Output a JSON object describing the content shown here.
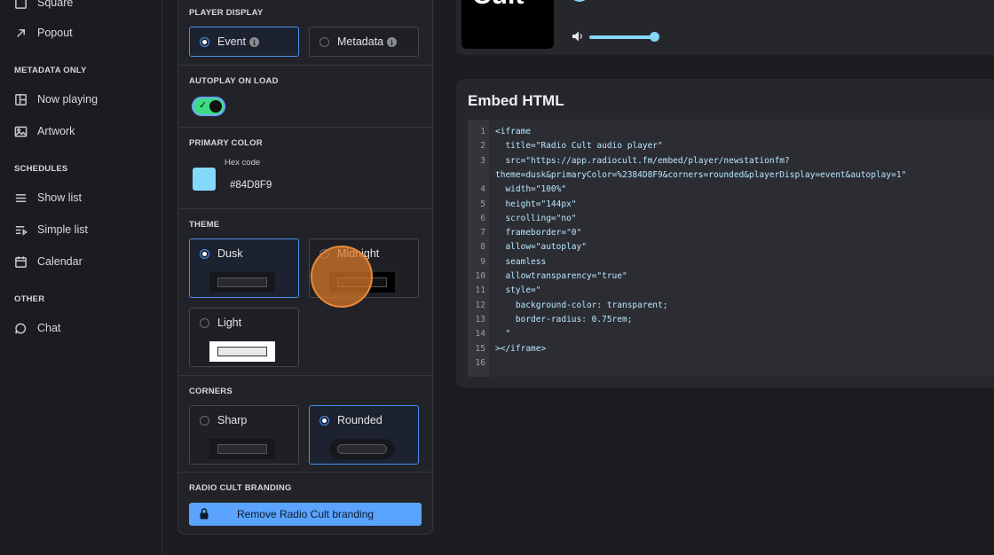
{
  "sidebar": {
    "items_top": [
      {
        "label": "Square",
        "icon": "square-icon"
      },
      {
        "label": "Popout",
        "icon": "arrow-up-right-icon"
      }
    ],
    "metadata_heading": "METADATA ONLY",
    "metadata_items": [
      {
        "label": "Now playing",
        "icon": "layout-icon"
      },
      {
        "label": "Artwork",
        "icon": "image-icon"
      }
    ],
    "schedules_heading": "SCHEDULES",
    "schedules_items": [
      {
        "label": "Show list",
        "icon": "menu-icon"
      },
      {
        "label": "Simple list",
        "icon": "list-play-icon"
      },
      {
        "label": "Calendar",
        "icon": "calendar-icon"
      }
    ],
    "other_heading": "OTHER",
    "other_items": [
      {
        "label": "Chat",
        "icon": "chat-icon"
      }
    ]
  },
  "settings": {
    "player_display": {
      "title": "PLAYER DISPLAY",
      "options": [
        {
          "label": "Event",
          "selected": true
        },
        {
          "label": "Metadata",
          "selected": false
        }
      ]
    },
    "autoplay": {
      "title": "AUTOPLAY ON LOAD",
      "enabled": true
    },
    "primary_color": {
      "title": "PRIMARY COLOR",
      "hex_label": "Hex code",
      "hex_value": "#84D8F9",
      "color": "#84D8F9"
    },
    "theme": {
      "title": "THEME",
      "options": [
        {
          "label": "Dusk",
          "selected": true
        },
        {
          "label": "Midnight",
          "selected": false
        },
        {
          "label": "Light",
          "selected": false
        }
      ]
    },
    "corners": {
      "title": "CORNERS",
      "options": [
        {
          "label": "Sharp",
          "selected": false
        },
        {
          "label": "Rounded",
          "selected": true
        }
      ]
    },
    "branding": {
      "title": "RADIO CULT BRANDING",
      "button_label": "Remove Radio Cult branding"
    }
  },
  "player_preview": {
    "cover_text": "Cult",
    "volume": 0.9
  },
  "embed": {
    "title": "Embed HTML",
    "lines": [
      "<iframe",
      "  title=\"Radio Cult audio player\"",
      "  src=\"https://app.radiocult.fm/embed/player/newstationfm?",
      "theme=dusk&primaryColor=%2384D8F9&corners=rounded&playerDisplay=event&autoplay=1\"",
      "  width=\"100%\"",
      "  height=\"144px\"",
      "  scrolling=\"no\"",
      "  frameborder=\"0\"",
      "  allow=\"autoplay\"",
      "  seamless",
      "  allowtransparency=\"true\"",
      "  style=\"",
      "    background-color: transparent;",
      "    border-radius: 0.75rem;",
      "  \"",
      "></iframe>",
      ""
    ],
    "line_numbers": [
      "1",
      "2",
      "3",
      "",
      "4",
      "5",
      "6",
      "7",
      "8",
      "9",
      "10",
      "11",
      "12",
      "13",
      "14",
      "15",
      "16"
    ]
  },
  "colors": {
    "accent": "#4a8ff0",
    "primary": "#84D8F9",
    "toggle_on": "#3ddc84",
    "brand_button": "#5aa3ff"
  }
}
